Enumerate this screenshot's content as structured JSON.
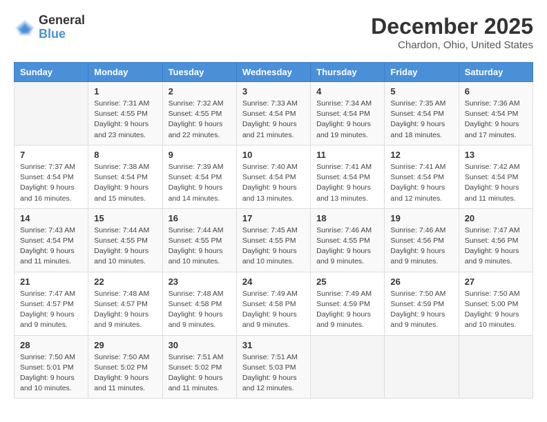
{
  "logo": {
    "general": "General",
    "blue": "Blue"
  },
  "title": {
    "month_year": "December 2025",
    "location": "Chardon, Ohio, United States"
  },
  "days_of_week": [
    "Sunday",
    "Monday",
    "Tuesday",
    "Wednesday",
    "Thursday",
    "Friday",
    "Saturday"
  ],
  "weeks": [
    [
      {
        "day": "",
        "info": ""
      },
      {
        "day": "1",
        "info": "Sunrise: 7:31 AM\nSunset: 4:55 PM\nDaylight: 9 hours\nand 23 minutes."
      },
      {
        "day": "2",
        "info": "Sunrise: 7:32 AM\nSunset: 4:55 PM\nDaylight: 9 hours\nand 22 minutes."
      },
      {
        "day": "3",
        "info": "Sunrise: 7:33 AM\nSunset: 4:54 PM\nDaylight: 9 hours\nand 21 minutes."
      },
      {
        "day": "4",
        "info": "Sunrise: 7:34 AM\nSunset: 4:54 PM\nDaylight: 9 hours\nand 19 minutes."
      },
      {
        "day": "5",
        "info": "Sunrise: 7:35 AM\nSunset: 4:54 PM\nDaylight: 9 hours\nand 18 minutes."
      },
      {
        "day": "6",
        "info": "Sunrise: 7:36 AM\nSunset: 4:54 PM\nDaylight: 9 hours\nand 17 minutes."
      }
    ],
    [
      {
        "day": "7",
        "info": "Sunrise: 7:37 AM\nSunset: 4:54 PM\nDaylight: 9 hours\nand 16 minutes."
      },
      {
        "day": "8",
        "info": "Sunrise: 7:38 AM\nSunset: 4:54 PM\nDaylight: 9 hours\nand 15 minutes."
      },
      {
        "day": "9",
        "info": "Sunrise: 7:39 AM\nSunset: 4:54 PM\nDaylight: 9 hours\nand 14 minutes."
      },
      {
        "day": "10",
        "info": "Sunrise: 7:40 AM\nSunset: 4:54 PM\nDaylight: 9 hours\nand 13 minutes."
      },
      {
        "day": "11",
        "info": "Sunrise: 7:41 AM\nSunset: 4:54 PM\nDaylight: 9 hours\nand 13 minutes."
      },
      {
        "day": "12",
        "info": "Sunrise: 7:41 AM\nSunset: 4:54 PM\nDaylight: 9 hours\nand 12 minutes."
      },
      {
        "day": "13",
        "info": "Sunrise: 7:42 AM\nSunset: 4:54 PM\nDaylight: 9 hours\nand 11 minutes."
      }
    ],
    [
      {
        "day": "14",
        "info": "Sunrise: 7:43 AM\nSunset: 4:54 PM\nDaylight: 9 hours\nand 11 minutes."
      },
      {
        "day": "15",
        "info": "Sunrise: 7:44 AM\nSunset: 4:55 PM\nDaylight: 9 hours\nand 10 minutes."
      },
      {
        "day": "16",
        "info": "Sunrise: 7:44 AM\nSunset: 4:55 PM\nDaylight: 9 hours\nand 10 minutes."
      },
      {
        "day": "17",
        "info": "Sunrise: 7:45 AM\nSunset: 4:55 PM\nDaylight: 9 hours\nand 10 minutes."
      },
      {
        "day": "18",
        "info": "Sunrise: 7:46 AM\nSunset: 4:55 PM\nDaylight: 9 hours\nand 9 minutes."
      },
      {
        "day": "19",
        "info": "Sunrise: 7:46 AM\nSunset: 4:56 PM\nDaylight: 9 hours\nand 9 minutes."
      },
      {
        "day": "20",
        "info": "Sunrise: 7:47 AM\nSunset: 4:56 PM\nDaylight: 9 hours\nand 9 minutes."
      }
    ],
    [
      {
        "day": "21",
        "info": "Sunrise: 7:47 AM\nSunset: 4:57 PM\nDaylight: 9 hours\nand 9 minutes."
      },
      {
        "day": "22",
        "info": "Sunrise: 7:48 AM\nSunset: 4:57 PM\nDaylight: 9 hours\nand 9 minutes."
      },
      {
        "day": "23",
        "info": "Sunrise: 7:48 AM\nSunset: 4:58 PM\nDaylight: 9 hours\nand 9 minutes."
      },
      {
        "day": "24",
        "info": "Sunrise: 7:49 AM\nSunset: 4:58 PM\nDaylight: 9 hours\nand 9 minutes."
      },
      {
        "day": "25",
        "info": "Sunrise: 7:49 AM\nSunset: 4:59 PM\nDaylight: 9 hours\nand 9 minutes."
      },
      {
        "day": "26",
        "info": "Sunrise: 7:50 AM\nSunset: 4:59 PM\nDaylight: 9 hours\nand 9 minutes."
      },
      {
        "day": "27",
        "info": "Sunrise: 7:50 AM\nSunset: 5:00 PM\nDaylight: 9 hours\nand 10 minutes."
      }
    ],
    [
      {
        "day": "28",
        "info": "Sunrise: 7:50 AM\nSunset: 5:01 PM\nDaylight: 9 hours\nand 10 minutes."
      },
      {
        "day": "29",
        "info": "Sunrise: 7:50 AM\nSunset: 5:02 PM\nDaylight: 9 hours\nand 11 minutes."
      },
      {
        "day": "30",
        "info": "Sunrise: 7:51 AM\nSunset: 5:02 PM\nDaylight: 9 hours\nand 11 minutes."
      },
      {
        "day": "31",
        "info": "Sunrise: 7:51 AM\nSunset: 5:03 PM\nDaylight: 9 hours\nand 12 minutes."
      },
      {
        "day": "",
        "info": ""
      },
      {
        "day": "",
        "info": ""
      },
      {
        "day": "",
        "info": ""
      }
    ]
  ]
}
